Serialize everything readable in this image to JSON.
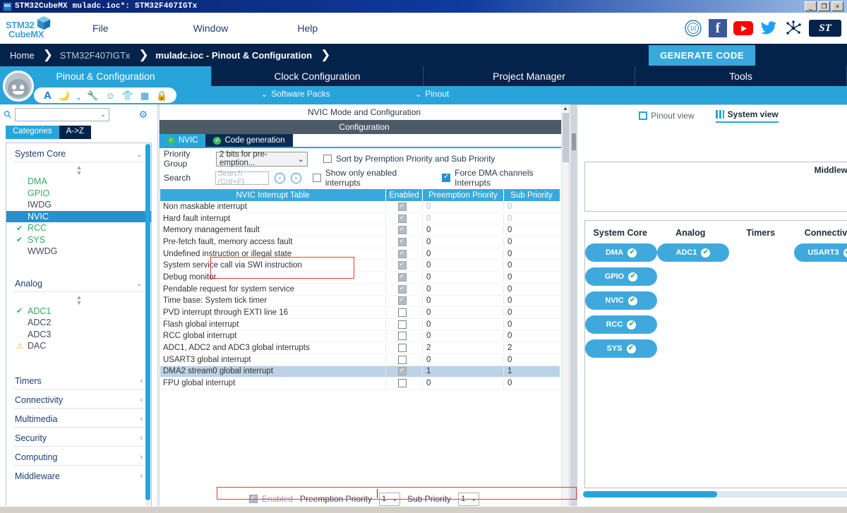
{
  "window": {
    "title": "STM32CubeMX muladc.ioc*: STM32F407IGTx",
    "app_icon": "MX",
    "minimize": "_",
    "maximize": "❐",
    "close": "×"
  },
  "logo": {
    "line1_a": "STM",
    "line1_b": "32",
    "line2": "CubeMX"
  },
  "menu": {
    "file": "File",
    "window": "Window",
    "help": "Help"
  },
  "social": {
    "anniversary": "10",
    "facebook": "f",
    "youtube": "▶",
    "twitter": "🐦",
    "community": "✳",
    "st": "ST"
  },
  "breadcrumb": {
    "home": "Home",
    "mcu": "STM32F407IGTx",
    "current": "muladc.ioc - Pinout & Configuration",
    "generate_code": "GENERATE CODE"
  },
  "main_tabs": [
    {
      "label": "Pinout & Configuration",
      "selected": true
    },
    {
      "label": "Clock Configuration",
      "selected": false
    },
    {
      "label": "Project Manager",
      "selected": false
    },
    {
      "label": "Tools",
      "selected": false
    }
  ],
  "sub_toolbar": {
    "software_packs": "Software Packs",
    "pinout": "Pinout",
    "caret": "⌄",
    "icons": [
      "font-icon",
      "moon-icon",
      "quote-icon",
      "wrench-icon",
      "smiley-icon",
      "shirt-icon",
      "grid-icon",
      "lock-icon"
    ]
  },
  "sidebar": {
    "search_placeholder": "",
    "combo_caret": "⌄",
    "tab_categories": "Categories",
    "tab_az": "A->Z",
    "groups": [
      {
        "name": "System Core",
        "expanded": true,
        "caret": "⌄",
        "items": [
          {
            "label": "DMA",
            "state": "green",
            "mark": ""
          },
          {
            "label": "GPIO",
            "state": "green",
            "mark": ""
          },
          {
            "label": "IWDG",
            "state": "none",
            "mark": ""
          },
          {
            "label": "NVIC",
            "state": "selected",
            "mark": ""
          },
          {
            "label": "RCC",
            "state": "green",
            "mark": "✔"
          },
          {
            "label": "SYS",
            "state": "green",
            "mark": "✔"
          },
          {
            "label": "WWDG",
            "state": "none",
            "mark": ""
          }
        ]
      },
      {
        "name": "Analog",
        "expanded": true,
        "caret": "⌄",
        "items": [
          {
            "label": "ADC1",
            "state": "green",
            "mark": "✔"
          },
          {
            "label": "ADC2",
            "state": "none",
            "mark": ""
          },
          {
            "label": "ADC3",
            "state": "none",
            "mark": ""
          },
          {
            "label": "DAC",
            "state": "warn",
            "mark": "⚠"
          }
        ]
      },
      {
        "name": "Timers",
        "expanded": false,
        "caret": "›",
        "items": []
      },
      {
        "name": "Connectivity",
        "expanded": false,
        "caret": "›",
        "items": []
      },
      {
        "name": "Multimedia",
        "expanded": false,
        "caret": "›",
        "items": []
      },
      {
        "name": "Security",
        "expanded": false,
        "caret": "›",
        "items": []
      },
      {
        "name": "Computing",
        "expanded": false,
        "caret": "›",
        "items": []
      },
      {
        "name": "Middleware",
        "expanded": false,
        "caret": "›",
        "items": []
      }
    ]
  },
  "center": {
    "mode_title": "NVIC Mode and Configuration",
    "configuration_bar": "Configuration",
    "tabs": [
      {
        "label": "NVIC",
        "selected": true
      },
      {
        "label": "Code generation",
        "selected": false
      }
    ],
    "priority_group_label": "Priority Group",
    "priority_group_value": "2 bits for pre-emption...",
    "priority_group_caret": "⌄",
    "sort_checkbox_label": "Sort by Premption Priority and Sub Priority",
    "sort_checked": false,
    "search_label": "Search",
    "search_placeholder": "Search (Crtl+F)",
    "prev_arrow": "‹",
    "next_arrow": "›",
    "show_only_enabled_label": "Show only enabled interrupts",
    "show_only_enabled_checked": false,
    "force_dma_label": "Force DMA channels Interrupts",
    "force_dma_checked": true,
    "table": {
      "headers": [
        "NVIC Interrupt Table",
        "Enabled",
        "Preemption Priority",
        "Sub Priority"
      ],
      "rows": [
        {
          "name": "Non maskable interrupt",
          "enabled": "readonly",
          "pre": "0",
          "sub": "0",
          "grey": true,
          "selected": false
        },
        {
          "name": "Hard fault interrupt",
          "enabled": "readonly",
          "pre": "0",
          "sub": "0",
          "grey": true,
          "selected": false
        },
        {
          "name": "Memory management fault",
          "enabled": "readonly",
          "pre": "0",
          "sub": "0",
          "grey": false,
          "selected": false
        },
        {
          "name": "Pre-fetch fault, memory access fault",
          "enabled": "readonly",
          "pre": "0",
          "sub": "0",
          "grey": false,
          "selected": false
        },
        {
          "name": "Undefined instruction or illegal state",
          "enabled": "readonly",
          "pre": "0",
          "sub": "0",
          "grey": false,
          "selected": false
        },
        {
          "name": "System service call via SWI instruction",
          "enabled": "readonly",
          "pre": "0",
          "sub": "0",
          "grey": false,
          "selected": false
        },
        {
          "name": "Debug monitor",
          "enabled": "readonly",
          "pre": "0",
          "sub": "0",
          "grey": false,
          "selected": false
        },
        {
          "name": "Pendable request for system service",
          "enabled": "readonly",
          "pre": "0",
          "sub": "0",
          "grey": false,
          "selected": false
        },
        {
          "name": "Time base: System tick timer",
          "enabled": "readonly",
          "pre": "0",
          "sub": "0",
          "grey": false,
          "selected": false
        },
        {
          "name": "PVD interrupt through EXTI line 16",
          "enabled": "unchecked",
          "pre": "0",
          "sub": "0",
          "grey": false,
          "selected": false
        },
        {
          "name": "Flash global interrupt",
          "enabled": "unchecked",
          "pre": "0",
          "sub": "0",
          "grey": false,
          "selected": false
        },
        {
          "name": "RCC global interrupt",
          "enabled": "unchecked",
          "pre": "0",
          "sub": "0",
          "grey": false,
          "selected": false
        },
        {
          "name": "ADC1, ADC2 and ADC3 global interrupts",
          "enabled": "unchecked",
          "pre": "2",
          "sub": "2",
          "grey": false,
          "selected": false
        },
        {
          "name": "USART3 global interrupt",
          "enabled": "unchecked",
          "pre": "0",
          "sub": "0",
          "grey": false,
          "selected": false
        },
        {
          "name": "DMA2 stream0 global interrupt",
          "enabled": "readonly",
          "pre": "1",
          "sub": "1",
          "grey": false,
          "selected": true
        },
        {
          "name": "FPU global interrupt",
          "enabled": "unchecked",
          "pre": "0",
          "sub": "0",
          "grey": false,
          "selected": false
        }
      ]
    },
    "footer": {
      "enabled_label": "Enabled",
      "enabled_checked": true,
      "preemption_label": "Preemption Priority",
      "preemption_value": "1",
      "sub_label": "Sub Priority",
      "sub_value": "1",
      "caret": "⌄"
    }
  },
  "right": {
    "view_tabs": [
      {
        "label": "Pinout view",
        "selected": false
      },
      {
        "label": "System view",
        "selected": true
      }
    ],
    "middleware_label": "Middleware",
    "columns": [
      {
        "title": "System Core",
        "chips": [
          {
            "label": "DMA",
            "ok": "✔"
          },
          {
            "label": "GPIO",
            "ok": "✔"
          },
          {
            "label": "NVIC",
            "ok": "✔"
          },
          {
            "label": "RCC",
            "ok": "✔"
          },
          {
            "label": "SYS",
            "ok": "✔"
          }
        ]
      },
      {
        "title": "Analog",
        "chips": [
          {
            "label": "ADC1",
            "ok": "✔"
          }
        ]
      },
      {
        "title": "Timers",
        "chips": []
      },
      {
        "title": "Connectivity",
        "chips": [
          {
            "label": "USART3",
            "ok": "✔"
          }
        ]
      }
    ]
  },
  "colors": {
    "accent_blue": "#29a4db",
    "dark_navy": "#03234b",
    "green_ok": "#3fbf62",
    "warn_yellow": "#f0b800",
    "highlight_red": "#e63b2e",
    "row_select": "#bcd2e6"
  }
}
